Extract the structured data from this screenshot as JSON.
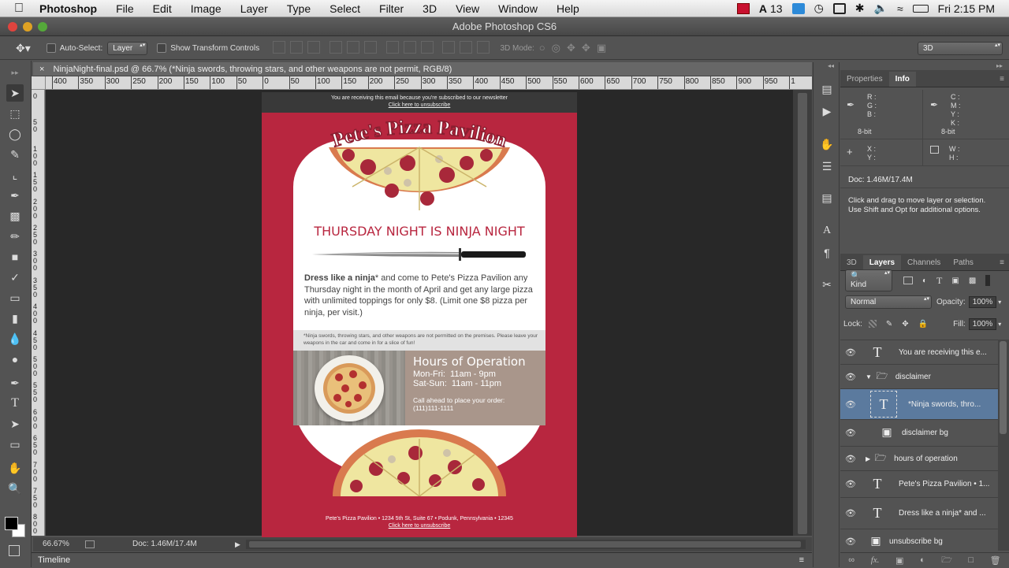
{
  "menubar": {
    "app_name": "Photoshop",
    "items": [
      "File",
      "Edit",
      "Image",
      "Layer",
      "Type",
      "Select",
      "Filter",
      "3D",
      "View",
      "Window",
      "Help"
    ],
    "num13": "13",
    "clock": "Fri 2:15 PM"
  },
  "window": {
    "title": "Adobe Photoshop CS6"
  },
  "options": {
    "auto_select_label": "Auto-Select:",
    "auto_select_value": "Layer",
    "transform_label": "Show Transform Controls",
    "mode3d_label": "3D Mode:",
    "workspace": "3D"
  },
  "document": {
    "tab_title": "NinjaNight-final.psd @ 66.7% (*Ninja swords, throwing stars, and other weapons are not permit, RGB/8)",
    "zoom": "66.67%",
    "doc_size": "Doc: 1.46M/17.4M"
  },
  "ruler": {
    "h_labels": [
      "400",
      "350",
      "300",
      "250",
      "200",
      "150",
      "100",
      "50",
      "0",
      "50",
      "100",
      "150",
      "200",
      "250",
      "300",
      "350",
      "400",
      "450",
      "500",
      "550",
      "600",
      "650",
      "700",
      "750",
      "800",
      "850",
      "900",
      "950",
      "1"
    ],
    "v_labels": [
      "0",
      "5 0",
      "1 0 0",
      "1 5 0",
      "2 0 0",
      "2 5 0",
      "3 0 0",
      "3 5 0",
      "4 0 0",
      "4 5 0",
      "5 0 0",
      "5 5 0",
      "6 0 0",
      "6 5 0",
      "7 0 0",
      "7 5 0",
      "8 0 0"
    ]
  },
  "email": {
    "top_notice": "You are receiving this email because you're subscribed to our newsletter",
    "top_unsub": "Click here to unsubscribe",
    "logo": "Pete's Pizza Pavilion",
    "headline": "THURSDAY NIGHT IS NINJA NIGHT",
    "body_bold": "Dress like a ninja",
    "body_rest": "* and come to Pete's Pizza Pavilion any Thursday night in the month of April and get any large pizza with unlimited toppings for only $8. (Limit one $8 pizza per ninja, per visit.)",
    "disclaimer": "*Ninja swords, throwing stars, and other weapons are not permitted on the premises. Please leave your weapons in the car and come in for a slice of fun!",
    "hours_title": "Hours of Operation",
    "hours_1": "Mon-Fri:  11am - 9pm",
    "hours_2": "Sat-Sun:  11am - 11pm",
    "call_1": "Call ahead to place your order:",
    "call_2": "(111)111-1111",
    "footer_addr": "Pete's Pizza Pavilion • 1234 5th St, Suite 67 • Podunk, Pennsylvania • 12345",
    "footer_unsub": "Click here to unsubscribe",
    "colors": {
      "red": "#b8263f",
      "hours_bg": "#a9968b"
    }
  },
  "info_panel": {
    "tabs": [
      "Properties",
      "Info"
    ],
    "rgb": [
      "R :",
      "G :",
      "B :"
    ],
    "cmyk": [
      "C :",
      "M :",
      "Y :",
      "K :"
    ],
    "bit_left": "8-bit",
    "bit_right": "8-bit",
    "xy": [
      "X :",
      "Y :"
    ],
    "wh": [
      "W :",
      "H :"
    ],
    "doc": "Doc: 1.46M/17.4M",
    "hint_1": "Click and drag to move layer or selection.",
    "hint_2": "Use Shift and Opt for additional options."
  },
  "layers_panel": {
    "tabs": [
      "3D",
      "Layers",
      "Channels",
      "Paths"
    ],
    "filter": "Kind",
    "blend_mode": "Normal",
    "opacity_label": "Opacity:",
    "opacity": "100%",
    "lock_label": "Lock:",
    "fill_label": "Fill:",
    "fill": "100%",
    "layers": [
      {
        "name": "You are receiving this e...",
        "kind": "text"
      },
      {
        "name": "disclaimer",
        "kind": "group-open"
      },
      {
        "name": "*Ninja swords, thro...",
        "kind": "text",
        "selected": true
      },
      {
        "name": "disclaimer bg",
        "kind": "shape"
      },
      {
        "name": "hours of operation",
        "kind": "group-closed"
      },
      {
        "name": "Pete's Pizza Pavilion • 1...",
        "kind": "text"
      },
      {
        "name": "Dress like a ninja* and ...",
        "kind": "text"
      },
      {
        "name": "unsubscribe bg",
        "kind": "shape"
      }
    ]
  },
  "timeline_label": "Timeline"
}
